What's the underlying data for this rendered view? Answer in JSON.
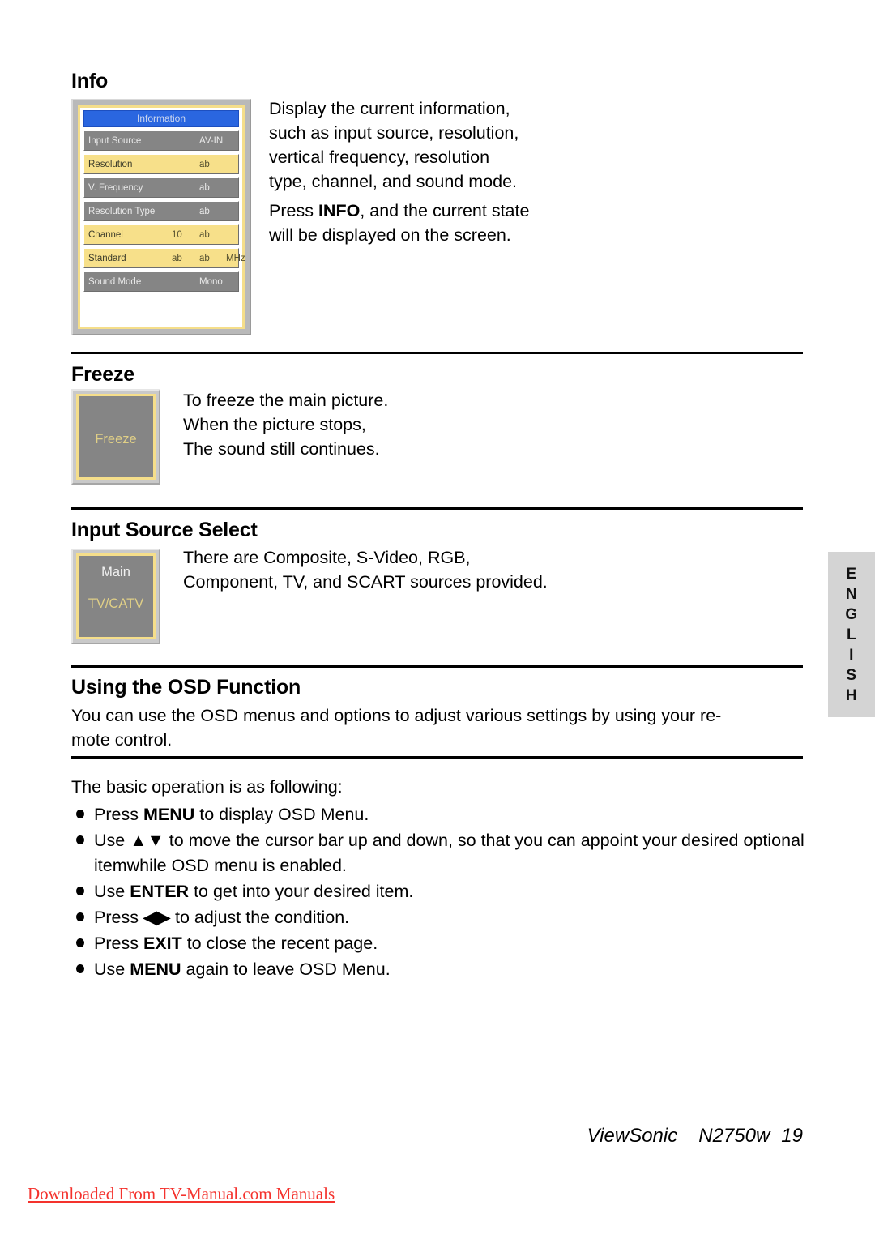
{
  "language_tab": {
    "label": "ENGLISH",
    "letters": [
      "E",
      "N",
      "G",
      "L",
      "I",
      "S",
      "H"
    ]
  },
  "sections": {
    "info": {
      "title": "Info",
      "paragraph1": "Display the current information, such as input source, resolution, vertical frequency, resolution type, channel, and sound mode.",
      "p1_lines": [
        "Display the current information,",
        "such as input source, resolution,",
        "vertical frequency, resolution",
        "type, channel, and sound mode."
      ],
      "p2_prefix": "Press ",
      "p2_bold": "INFO",
      "p2_line1_suffix": ", and the current state",
      "p2_line2": "will be displayed on the screen.",
      "osd": {
        "title": "Information",
        "rows": [
          {
            "label": "Input Source",
            "value": "AV-IN",
            "style": "gray",
            "align": "center"
          },
          {
            "label": "Resolution",
            "value": "ab",
            "style": "yellow",
            "align": "right"
          },
          {
            "label": "V. Frequency",
            "value": "ab",
            "style": "gray",
            "align": "right"
          },
          {
            "label": "Resolution Type",
            "value": "ab",
            "style": "gray",
            "align": "right"
          },
          {
            "label": "Channel",
            "value": "10",
            "value2": "ab",
            "style": "yellow",
            "align": "multi"
          },
          {
            "label": "Standard",
            "value": "ab",
            "value2": "ab",
            "value3": "MHz",
            "style": "yellow",
            "align": "multi3"
          },
          {
            "label": "Sound Mode",
            "value": "Mono",
            "style": "gray",
            "align": "center"
          }
        ]
      }
    },
    "freeze": {
      "title": "Freeze",
      "box_label": "Freeze",
      "lines": [
        "To freeze the main picture.",
        "When the picture stops,",
        "The sound still continues."
      ]
    },
    "input_source_select": {
      "title": "Input Source Select",
      "box_top_label": "Main",
      "box_center_label": "TV/CATV",
      "lines": [
        "There are Composite, S-Video, RGB,",
        "Component, TV, and SCART sources provided."
      ]
    },
    "using_osd": {
      "title": "Using the OSD Function",
      "intro_line1": "You can use the OSD menus and options to adjust various settings by using your re-",
      "intro_line2": "mote control.",
      "basic_intro": "The basic operation is as following:",
      "bullets": [
        {
          "pre": "Press ",
          "bold": "MENU",
          "post": " to display OSD Menu."
        },
        {
          "pre": "Use ",
          "bold": "▲▼",
          "post": " to move the cursor bar up and down, so that you can appoint your desired optional itemwhile OSD menu is enabled.",
          "bold_is_symbol": true
        },
        {
          "pre": "Use ",
          "bold": "ENTER",
          "post": " to get into your desired item."
        },
        {
          "pre": "Press ",
          "bold": "◀▶",
          "post": " to adjust the condition.",
          "bold_is_symbol": true
        },
        {
          "pre": "Press ",
          "bold": "EXIT",
          "post": " to close the recent page."
        },
        {
          "pre": "Use ",
          "bold": "MENU",
          "post": " again to leave OSD Menu."
        }
      ]
    }
  },
  "footer": {
    "brand": "ViewSonic",
    "model": "N2750w",
    "page_number": "19"
  },
  "download_note": "Downloaded From TV-Manual.com Manuals",
  "colors": {
    "osd_title_blue": "#2a66e0",
    "osd_row_gray": "#858585",
    "osd_row_yellow": "#f7e08a",
    "osd_border_yellow": "#f5de8a",
    "lang_tab_bg": "#d4d4d4",
    "note_red": "#f4322d"
  }
}
